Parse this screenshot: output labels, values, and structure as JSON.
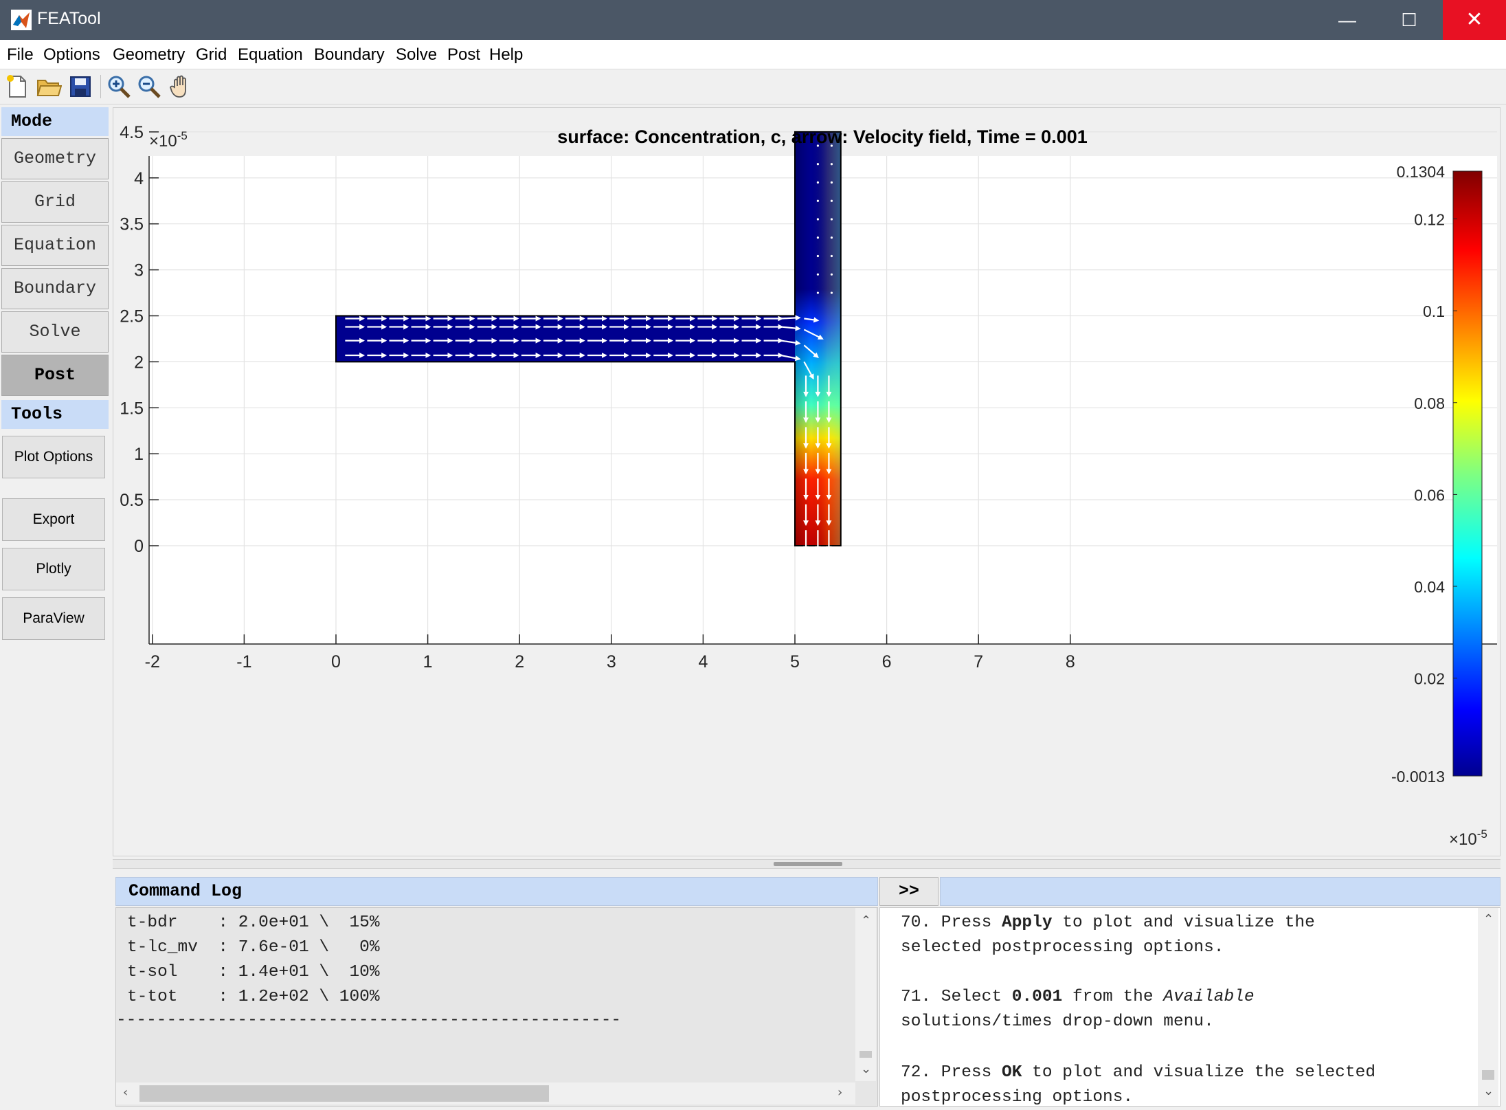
{
  "window": {
    "title": "FEATool"
  },
  "menu": [
    "File",
    "Options",
    "Geometry",
    "Grid",
    "Equation",
    "Boundary",
    "Solve",
    "Post",
    "Help"
  ],
  "toolbar": {
    "icons": [
      "new-file-icon",
      "open-folder-icon",
      "save-icon",
      "zoom-in-icon",
      "zoom-out-icon",
      "pan-hand-icon"
    ]
  },
  "left_panel": {
    "mode_header": "Mode",
    "mode_buttons": [
      "Geometry",
      "Grid",
      "Equation",
      "Boundary",
      "Solve",
      "Post"
    ],
    "active_mode": "Post",
    "tools_header": "Tools",
    "tool_buttons": [
      "Plot Options",
      "Export",
      "Plotly",
      "ParaView"
    ]
  },
  "plot": {
    "title": "surface: Concentration, c, arrow: Velocity field, Time = 0.001",
    "x_exponent_label": "×10",
    "x_exponent": "-5",
    "y_exponent_label": "×10",
    "y_exponent": "-5",
    "x_ticks": [
      "-2",
      "-1",
      "0",
      "1",
      "2",
      "3",
      "4",
      "5",
      "6",
      "7",
      "8"
    ],
    "y_ticks": [
      "0",
      "0.5",
      "1",
      "1.5",
      "2",
      "2.5",
      "3",
      "3.5",
      "4",
      "4.5"
    ],
    "colorbar_labels": [
      "0.1304",
      "0.12",
      "0.1",
      "0.08",
      "0.06",
      "0.04",
      "0.02",
      "-0.0013"
    ],
    "colorbar_min": -0.0013,
    "colorbar_max": 0.1304,
    "colormap": "jet"
  },
  "command_log": {
    "header": "Command Log",
    "expand_button": ">>",
    "lines": [
      "t-bdr    : 2.0e+01 \\  15%",
      "t-lc_mv  : 7.6e-01 \\   0%",
      "t-sol    : 1.4e+01 \\  10%",
      "t-tot    : 1.2e+02 \\ 100%",
      "--------------------------------------------------"
    ]
  },
  "hints": {
    "step70_prefix": "70. Press ",
    "step70_bold": "Apply",
    "step70_suffix": " to plot and visualize the",
    "step70_line2": "selected postprocessing options.",
    "step71_prefix": "71. Select ",
    "step71_bold": "0.001",
    "step71_mid": " from the ",
    "step71_italic": "Available",
    "step71_line2": "solutions/times drop-down menu.",
    "step72_prefix": "72. Press ",
    "step72_bold": "OK",
    "step72_suffix": " to plot and visualize the selected",
    "step72_line2": "postprocessing options."
  }
}
